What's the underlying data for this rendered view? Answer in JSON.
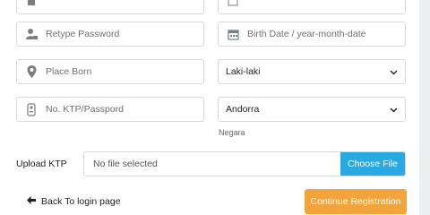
{
  "form": {
    "retype_password": {
      "placeholder": "Retype Password",
      "icon": "user-lock-icon"
    },
    "birth_date": {
      "placeholder": "Birth Date / year-month-date",
      "icon": "calendar-icon"
    },
    "place_born": {
      "placeholder": "Place Born",
      "icon": "location-pin-icon"
    },
    "gender": {
      "value": "Laki-laki",
      "icon": "chevron-down-icon"
    },
    "ktp_passport": {
      "placeholder": "No. KTP/Passpord",
      "icon": "id-card-icon"
    },
    "country": {
      "value": "Andorra",
      "hint": "Negara",
      "icon": "chevron-down-icon"
    }
  },
  "upload": {
    "label": "Upload KTP",
    "status": "No file selected",
    "button": "Choose File"
  },
  "footer": {
    "back_label": "Back To login page",
    "back_icon": "arrow-left-icon",
    "continue_label": "Continue Registration"
  },
  "colors": {
    "choose_file": "#29a9e1",
    "continue": "#f2a33a"
  }
}
